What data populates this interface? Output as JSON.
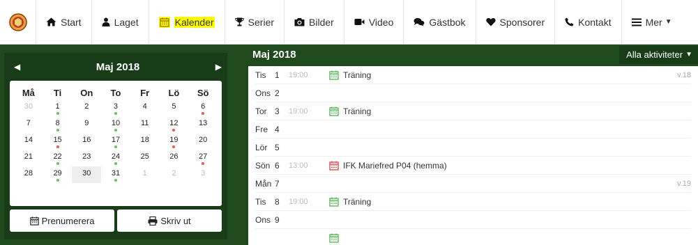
{
  "nav": {
    "items": [
      {
        "name": "nav-start",
        "icon": "home-icon",
        "label": "Start"
      },
      {
        "name": "nav-laget",
        "icon": "user-icon",
        "label": "Laget"
      },
      {
        "name": "nav-kalender",
        "icon": "calendar-icon",
        "label": "Kalender",
        "active": true
      },
      {
        "name": "nav-serier",
        "icon": "trophy-icon",
        "label": "Serier"
      },
      {
        "name": "nav-bilder",
        "icon": "camera-icon",
        "label": "Bilder"
      },
      {
        "name": "nav-video",
        "icon": "video-icon",
        "label": "Video"
      },
      {
        "name": "nav-gastbok",
        "icon": "comments-icon",
        "label": "Gästbok"
      },
      {
        "name": "nav-sponsorer",
        "icon": "heart-icon",
        "label": "Sponsorer"
      },
      {
        "name": "nav-kontakt",
        "icon": "phone-icon",
        "label": "Kontakt"
      },
      {
        "name": "nav-mer",
        "icon": "menu-icon",
        "label": "Mer"
      }
    ],
    "highlight_color": "#ffff00"
  },
  "calendar": {
    "title": "Maj 2018",
    "weekdays": [
      "Må",
      "Ti",
      "On",
      "To",
      "Fr",
      "Lö",
      "Sö"
    ],
    "days": [
      {
        "n": "30",
        "muted": true,
        "dot": ""
      },
      {
        "n": "1",
        "dot": "g"
      },
      {
        "n": "2",
        "dot": ""
      },
      {
        "n": "3",
        "dot": "g"
      },
      {
        "n": "4",
        "dot": ""
      },
      {
        "n": "5",
        "dot": ""
      },
      {
        "n": "6",
        "dot": "r"
      },
      {
        "n": "7",
        "dot": ""
      },
      {
        "n": "8",
        "dot": "g"
      },
      {
        "n": "9",
        "dot": ""
      },
      {
        "n": "10",
        "dot": "g"
      },
      {
        "n": "11",
        "dot": ""
      },
      {
        "n": "12",
        "dot": "r"
      },
      {
        "n": "13",
        "dot": ""
      },
      {
        "n": "14",
        "dot": ""
      },
      {
        "n": "15",
        "dot": "r"
      },
      {
        "n": "16",
        "dot": ""
      },
      {
        "n": "17",
        "dot": "g"
      },
      {
        "n": "18",
        "dot": ""
      },
      {
        "n": "19",
        "dot": "r"
      },
      {
        "n": "20",
        "dot": ""
      },
      {
        "n": "21",
        "dot": ""
      },
      {
        "n": "22",
        "dot": "g"
      },
      {
        "n": "23",
        "dot": ""
      },
      {
        "n": "24",
        "dot": "g"
      },
      {
        "n": "25",
        "dot": ""
      },
      {
        "n": "26",
        "dot": ""
      },
      {
        "n": "27",
        "dot": "r"
      },
      {
        "n": "28",
        "dot": ""
      },
      {
        "n": "29",
        "dot": "g"
      },
      {
        "n": "30",
        "dot": "",
        "today": true
      },
      {
        "n": "31",
        "dot": "g"
      },
      {
        "n": "1",
        "muted": true,
        "dot": ""
      },
      {
        "n": "2",
        "muted": true,
        "dot": ""
      },
      {
        "n": "3",
        "muted": true,
        "dot": ""
      }
    ],
    "subscribe_label": "Prenumerera",
    "print_label": "Skriv ut"
  },
  "agenda": {
    "title": "Maj 2018",
    "filter_label": "Alla aktiviteter",
    "rows": [
      {
        "dname": "Tis",
        "dnum": "1",
        "time": "19:00",
        "event": "Träning",
        "type": "training",
        "week": "v.18"
      },
      {
        "dname": "Ons",
        "dnum": "2",
        "time": "",
        "event": "",
        "type": "",
        "week": ""
      },
      {
        "dname": "Tor",
        "dnum": "3",
        "time": "19:00",
        "event": "Träning",
        "type": "training",
        "week": ""
      },
      {
        "dname": "Fre",
        "dnum": "4",
        "time": "",
        "event": "",
        "type": "",
        "week": ""
      },
      {
        "dname": "Lör",
        "dnum": "5",
        "time": "",
        "event": "",
        "type": "",
        "week": ""
      },
      {
        "dname": "Sön",
        "dnum": "6",
        "time": "13:00",
        "event": "IFK Mariefred P04 (hemma)",
        "type": "match",
        "week": ""
      },
      {
        "dname": "Mån",
        "dnum": "7",
        "time": "",
        "event": "",
        "type": "",
        "week": "v.19"
      },
      {
        "dname": "Tis",
        "dnum": "8",
        "time": "19:00",
        "event": "Träning",
        "type": "training",
        "week": ""
      },
      {
        "dname": "Ons",
        "dnum": "9",
        "time": "",
        "event": "",
        "type": "",
        "week": ""
      },
      {
        "dname": "",
        "dnum": "",
        "time": "",
        "event": "",
        "type": "training",
        "week": ""
      }
    ],
    "colors": {
      "training": "#5cb85c",
      "match": "#e05050"
    }
  }
}
